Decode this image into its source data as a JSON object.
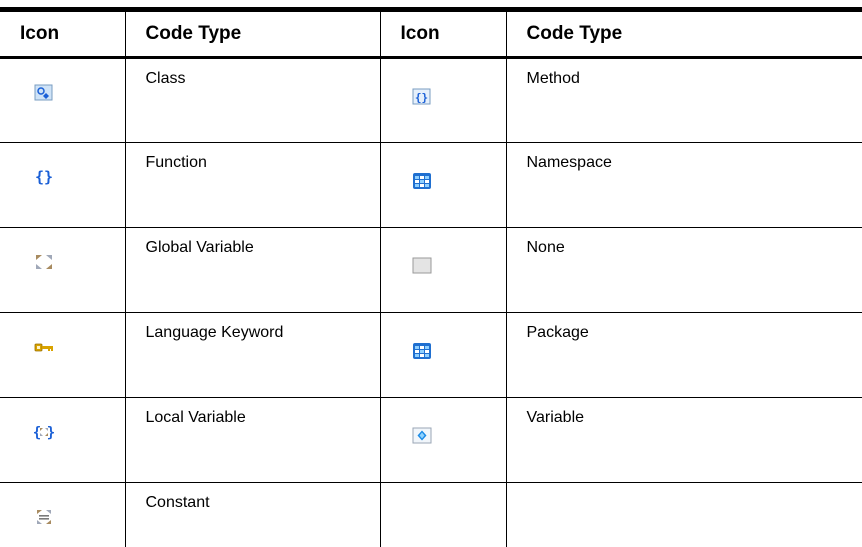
{
  "table": {
    "headers": [
      "Icon",
      "Code Type",
      "Icon",
      "Code Type"
    ],
    "rows": [
      {
        "left": {
          "icon": "class-icon",
          "label": "Class"
        },
        "right": {
          "icon": "method-icon",
          "label": "Method"
        }
      },
      {
        "left": {
          "icon": "function-icon",
          "label": "Function"
        },
        "right": {
          "icon": "namespace-icon",
          "label": "Namespace"
        }
      },
      {
        "left": {
          "icon": "global-variable-icon",
          "label": "Global Variable"
        },
        "right": {
          "icon": "none-icon",
          "label": "None"
        }
      },
      {
        "left": {
          "icon": "language-keyword-icon",
          "label": "Language Keyword"
        },
        "right": {
          "icon": "package-icon",
          "label": "Package"
        }
      },
      {
        "left": {
          "icon": "local-variable-icon",
          "label": "Local Variable"
        },
        "right": {
          "icon": "variable-icon",
          "label": "Variable"
        }
      },
      {
        "left": {
          "icon": "constant-icon",
          "label": "Constant"
        },
        "right": {
          "icon": "",
          "label": ""
        }
      }
    ]
  },
  "colors": {
    "rule": "#000000",
    "brace_blue": "#1a5fd6",
    "key_gold": "#d9a300",
    "grid_blue": "#1f6fd0"
  }
}
